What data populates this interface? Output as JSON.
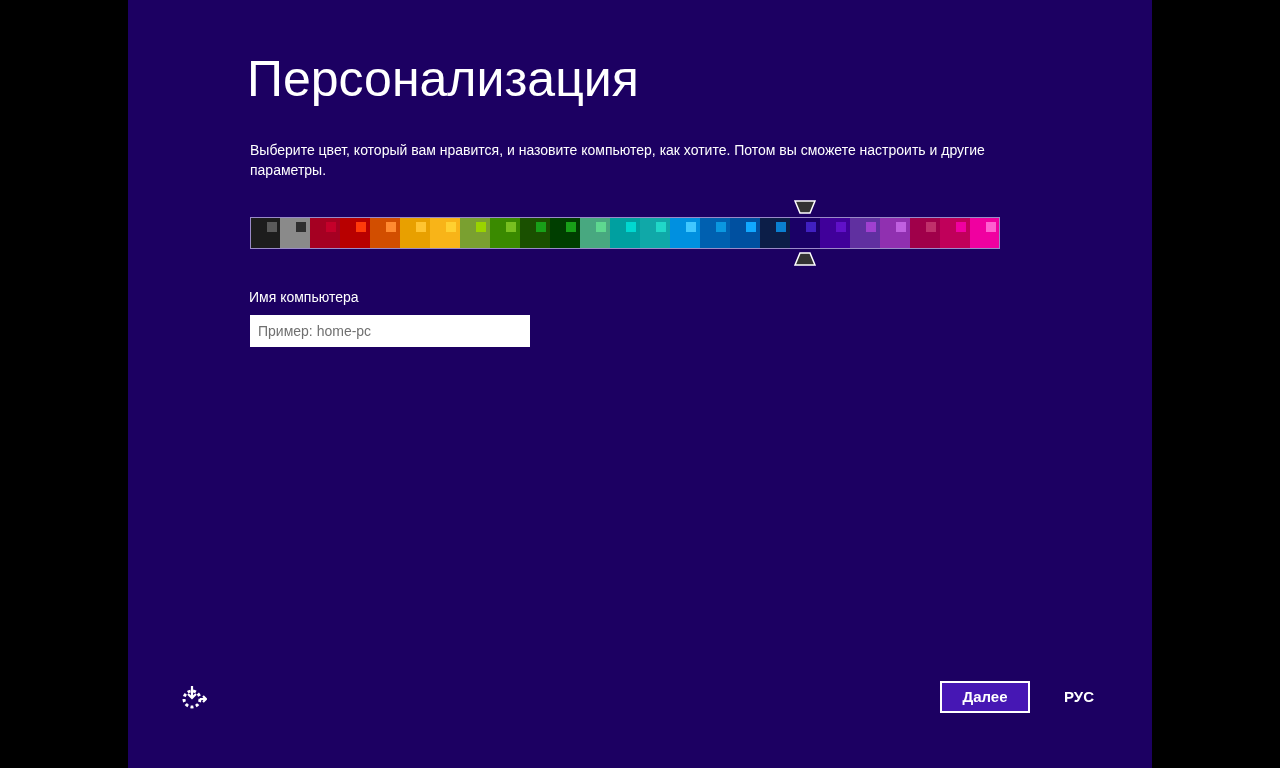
{
  "title": "Персонализация",
  "description": "Выберите цвет, который вам нравится, и назовите компьютер, как хотите. Потом вы сможете настроить и другие параметры.",
  "swatches": [
    {
      "color": "#1d1d1d",
      "accent": {
        "color": "#5a5a5a"
      },
      "selected": false
    },
    {
      "color": "#8a8a8a",
      "accent": {
        "color": "#2f2f2f"
      },
      "selected": false
    },
    {
      "color": "#a50022",
      "accent": {
        "color": "#c4002a"
      },
      "selected": false
    },
    {
      "color": "#b80000",
      "accent": {
        "color": "#ff3a0a"
      },
      "selected": false
    },
    {
      "color": "#d24e00",
      "accent": {
        "color": "#ff8a30"
      },
      "selected": false
    },
    {
      "color": "#e8a000",
      "accent": {
        "color": "#ffc430"
      },
      "selected": false
    },
    {
      "color": "#f8b418",
      "accent": {
        "color": "#ffd030"
      },
      "selected": false
    },
    {
      "color": "#7aa030",
      "accent": {
        "color": "#9ad300"
      },
      "selected": false
    },
    {
      "color": "#3a8a00",
      "accent": {
        "color": "#78c020"
      },
      "selected": false
    },
    {
      "color": "#1a5000",
      "accent": {
        "color": "#18a018"
      },
      "selected": false
    },
    {
      "color": "#003e00",
      "accent": {
        "color": "#18a018"
      },
      "selected": false
    },
    {
      "color": "#48a880",
      "accent": {
        "color": "#5ed890"
      },
      "selected": false
    },
    {
      "color": "#00a0a0",
      "accent": {
        "color": "#00d8d0"
      },
      "selected": false
    },
    {
      "color": "#10a8a8",
      "accent": {
        "color": "#20d8c8"
      },
      "selected": false
    },
    {
      "color": "#0090e0",
      "accent": {
        "color": "#40c8ff"
      },
      "selected": false
    },
    {
      "color": "#0060b0",
      "accent": {
        "color": "#0a98e0"
      },
      "selected": false
    },
    {
      "color": "#0050a0",
      "accent": {
        "color": "#10a8ff"
      },
      "selected": false
    },
    {
      "color": "#0c1e48",
      "accent": {
        "color": "#0a80d0"
      },
      "selected": false
    },
    {
      "color": "#1a0066",
      "accent": {
        "color": "#4020c0"
      },
      "selected": true
    },
    {
      "color": "#40009a",
      "accent": {
        "color": "#6010c8"
      },
      "selected": false
    },
    {
      "color": "#6030a0",
      "accent": {
        "color": "#a040d0"
      },
      "selected": false
    },
    {
      "color": "#9030b0",
      "accent": {
        "color": "#c060e0"
      },
      "selected": false
    },
    {
      "color": "#a0004a",
      "accent": {
        "color": "#c0306a"
      },
      "selected": false
    },
    {
      "color": "#c0005a",
      "accent": {
        "color": "#f000a0"
      },
      "selected": false
    },
    {
      "color": "#f000a0",
      "accent": {
        "color": "#ff60d0"
      },
      "selected": false
    }
  ],
  "name_field": {
    "label": "Имя компьютера",
    "placeholder": "Пример: home-pc"
  },
  "next_button": "Далее",
  "language": "РУС"
}
